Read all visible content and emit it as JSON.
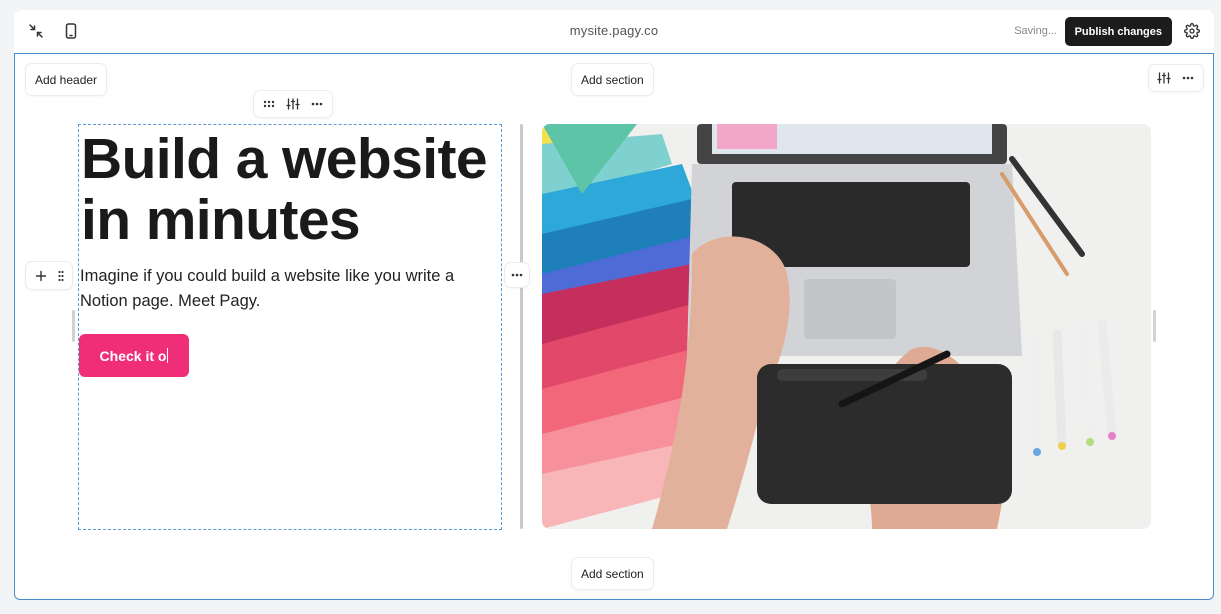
{
  "topbar": {
    "domain": "mysite.pagy.co",
    "status": "Saving...",
    "publish_label": "Publish changes",
    "icons": [
      "collapse-icon",
      "mobile-preview-icon",
      "gear-icon"
    ]
  },
  "canvas": {
    "add_header_label": "Add header",
    "add_section_top_label": "Add section",
    "add_section_bottom_label": "Add section",
    "hero": {
      "headline": "Build a website in minutes",
      "subtext": "Imagine if you could build a website like you write a Notion page. Meet Pagy.",
      "cta_label": "Check it o"
    },
    "image_alt": "Hands using a laptop and drawing tablet with color swatches and markers"
  },
  "colors": {
    "accent": "#f02d77",
    "selection": "#4a8ec9",
    "publish_bg": "#1c1c1c"
  }
}
